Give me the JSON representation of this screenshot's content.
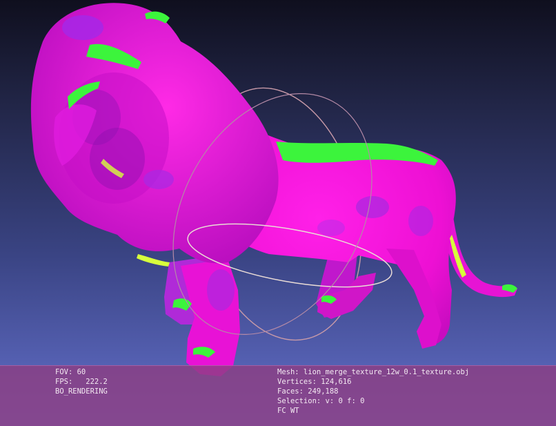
{
  "viewer": {
    "model_icon": "lion-mesh",
    "trackball_icon": "trackball-gizmo",
    "colors": {
      "background_top": "#0f0f1e",
      "background_bottom": "#6470cc",
      "mesh_magenta": "#ff12e0",
      "mesh_purple": "#b42cff",
      "mesh_green": "#3cf43c",
      "mesh_yellow": "#d8ff3c",
      "info_bar": "#8c3e82"
    }
  },
  "info": {
    "fov": "FOV: 60",
    "fps": "FPS:   222.2",
    "render_mode": "BO_RENDERING",
    "mesh": "Mesh: lion_merge_texture_12w_0.1_texture.obj",
    "vertices": "Vertices: 124,616",
    "faces": "Faces: 249,188",
    "selection": "Selection: v: 0 f: 0",
    "flags": "FC WT"
  }
}
